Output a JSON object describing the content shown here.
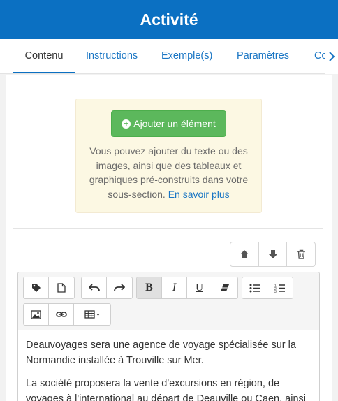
{
  "header": {
    "title": "Activité"
  },
  "tabs": [
    {
      "label": "Contenu"
    },
    {
      "label": "Instructions"
    },
    {
      "label": "Exemple(s)"
    },
    {
      "label": "Paramètres"
    },
    {
      "label": "Co"
    }
  ],
  "info_box": {
    "add_button_label": "Ajouter un élément",
    "text": "Vous pouvez ajouter du texte ou des images, ainsi que des tableaux et graphiques pré-construits dans votre sous-section.",
    "link_label": "En savoir plus"
  },
  "toolbar": {
    "icons": [
      "tag-icon",
      "file-icon",
      "undo-icon",
      "redo-icon",
      "bold-icon",
      "italic-icon",
      "underline-icon",
      "eraser-icon",
      "bulleted-list-icon",
      "numbered-list-icon",
      "image-icon",
      "link-icon",
      "table-icon"
    ],
    "bold_label": "B",
    "italic_label": "I",
    "underline_label": "U"
  },
  "editor": {
    "paragraphs": [
      "Deauvoyages sera une agence de voyage spécialisée sur la Normandie installée à Trouville sur Mer.",
      "La société proposera la vente d'excursions en région, de voyages à l'international au départ de Deauville ou Caen, ainsi"
    ]
  },
  "colors": {
    "header": "#0b70c2",
    "accent": "#1a76c4",
    "success": "#5cb85c",
    "info_bg": "#fcf8e3"
  }
}
